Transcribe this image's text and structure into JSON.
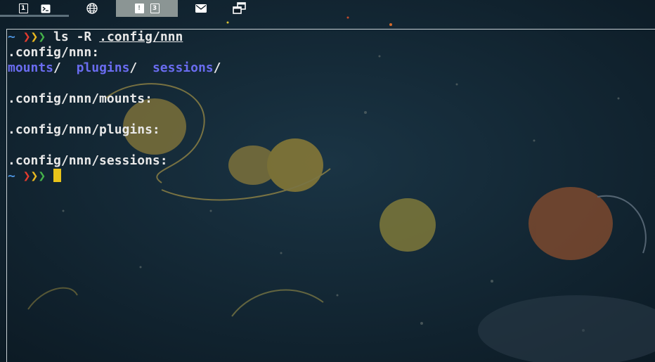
{
  "topbar": {
    "workspaces": [
      {
        "label": "1",
        "icon": "workspace-one-icon"
      },
      {
        "label": "",
        "icon": "terminal-icon"
      },
      {
        "label": "",
        "icon": "globe-icon"
      },
      {
        "label": "!",
        "label2": "3",
        "icon": "urgent-icon"
      },
      {
        "label": "",
        "icon": "mail-icon"
      },
      {
        "label": "",
        "icon": "windows-icon"
      }
    ],
    "active_color": "#8b9594"
  },
  "terminal": {
    "prompt": {
      "tilde": "~",
      "chevrons": [
        "❯",
        "❯",
        "❯"
      ]
    },
    "command": {
      "name": "ls",
      "flag": "-R",
      "path": ".config/nnn"
    },
    "output": {
      "root_header": ".config/nnn:",
      "dirs": [
        "mounts",
        "plugins",
        "sessions"
      ],
      "slash": "/",
      "sub_headers": [
        ".config/nnn/mounts:",
        ".config/nnn/plugins:",
        ".config/nnn/sessions:"
      ]
    }
  },
  "colors": {
    "tilde": "#4a90d9",
    "chevron_red": "#e23b2e",
    "chevron_yellow": "#e8b820",
    "chevron_green": "#45b34a",
    "directory": "#6a6cf0",
    "cursor": "#e8c31a"
  }
}
